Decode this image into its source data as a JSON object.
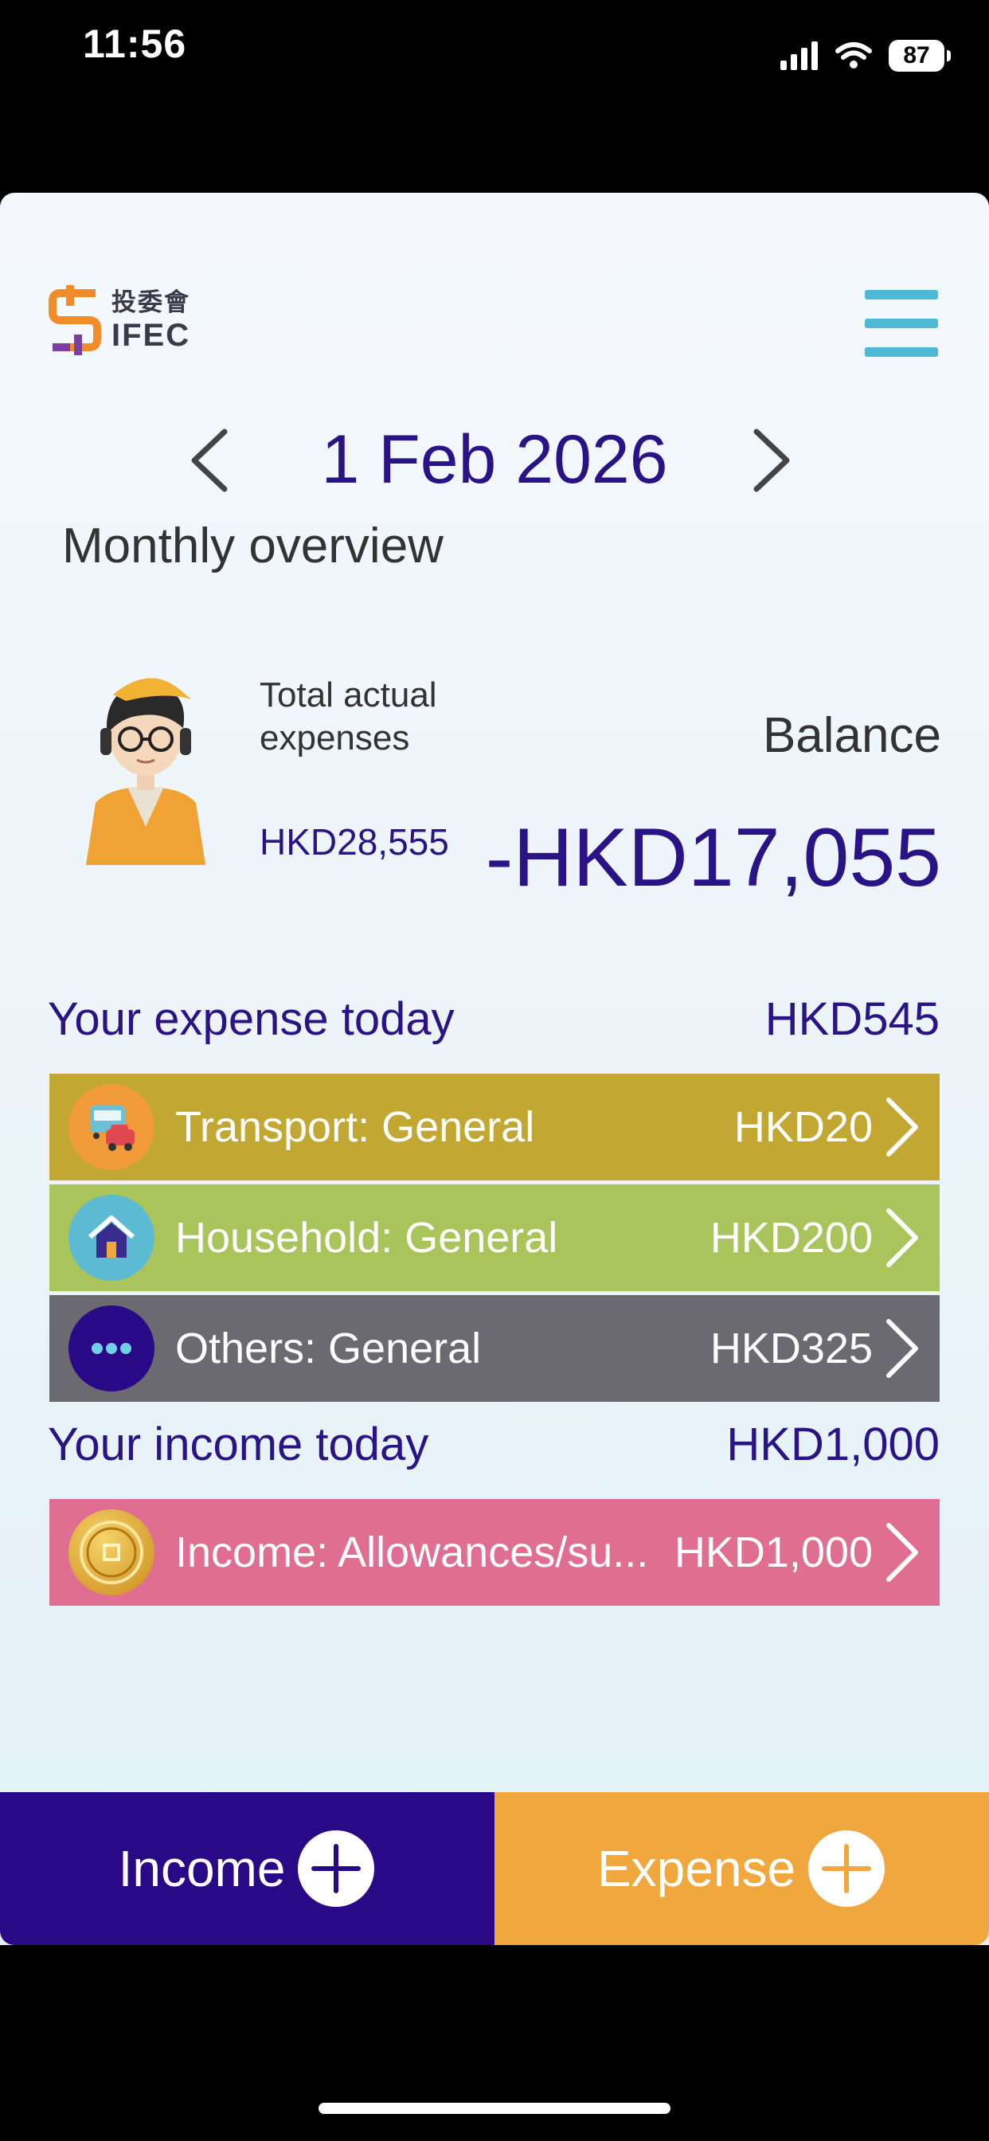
{
  "status": {
    "time": "11:56",
    "battery": "87"
  },
  "header": {
    "logo_cn": "投委會",
    "logo_en": "IFEC"
  },
  "date_nav": {
    "date": "1 Feb 2026"
  },
  "overview": {
    "title": "Monthly overview",
    "total_label": "Total actual expenses",
    "total_value": "HKD28,555",
    "balance_label": "Balance",
    "balance_value": "-HKD17,055"
  },
  "expense_today": {
    "label": "Your expense today",
    "total": "HKD545",
    "items": [
      {
        "name": "Transport: General",
        "amount": "HKD20",
        "icon": "bus-car-icon",
        "color": "#c2a833"
      },
      {
        "name": "Household: General",
        "amount": "HKD200",
        "icon": "house-icon",
        "color": "#a8c45a"
      },
      {
        "name": "Others: General",
        "amount": "HKD325",
        "icon": "more-dots-icon",
        "color": "#6a6a70"
      }
    ]
  },
  "income_today": {
    "label": "Your income today",
    "total": "HKD1,000",
    "items": [
      {
        "name": "Income: Allowances/su...",
        "amount": "HKD1,000",
        "icon": "coin-icon",
        "color": "#df6e91"
      }
    ]
  },
  "bottom": {
    "income_label": "Income",
    "expense_label": "Expense"
  },
  "colors": {
    "brand": "#2a1386",
    "accent": "#4cb8d4",
    "income_button": "#2a0986",
    "expense_button": "#f0a83e"
  }
}
